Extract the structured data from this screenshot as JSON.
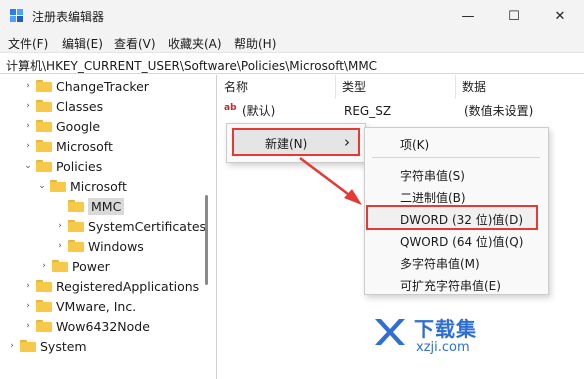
{
  "window": {
    "title": "注册表编辑器",
    "min": "—",
    "max": "☐",
    "close": "✕"
  },
  "menu": [
    "文件(F)",
    "编辑(E)",
    "查看(V)",
    "收藏夹(A)",
    "帮助(H)"
  ],
  "address": "计算机\\HKEY_CURRENT_USER\\Software\\Policies\\Microsoft\\MMC",
  "tree": [
    {
      "label": "ChangeTracker"
    },
    {
      "label": "Classes"
    },
    {
      "label": "Google"
    },
    {
      "label": "Microsoft"
    },
    {
      "label": "Policies"
    },
    {
      "label": "Microsoft"
    },
    {
      "label": "MMC"
    },
    {
      "label": "SystemCertificates"
    },
    {
      "label": "Windows"
    },
    {
      "label": "Power"
    },
    {
      "label": "RegisteredApplications"
    },
    {
      "label": "VMware, Inc."
    },
    {
      "label": "Wow6432Node"
    },
    {
      "label": "System"
    }
  ],
  "columns": {
    "name": "名称",
    "type": "类型",
    "data": "数据"
  },
  "value_row": {
    "name": "(默认)",
    "type": "REG_SZ",
    "data": "(数值未设置)"
  },
  "icon_ab": "ab",
  "context_menu": {
    "new": "新建(N)",
    "arrow": "›"
  },
  "submenu": {
    "key": "项(K)",
    "items": [
      "字符串值(S)",
      "二进制值(B)",
      "DWORD (32 位)值(D)",
      "QWORD (64 位)值(Q)",
      "多字符串值(M)",
      "可扩充字符串值(E)"
    ]
  },
  "watermark": {
    "title": "下载集",
    "url": "xzji.com"
  },
  "colors": {
    "highlight_border": "#e53935",
    "folder": "#f7c948",
    "watermark": "#2f6fd3"
  }
}
